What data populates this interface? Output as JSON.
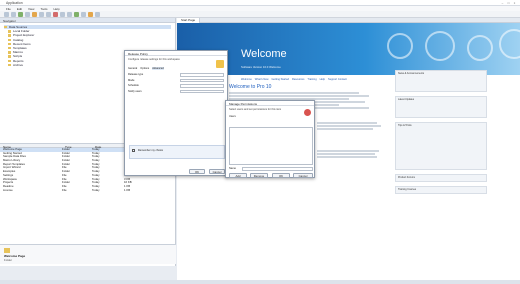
{
  "menu": [
    "File",
    "Edit",
    "View",
    "Tools",
    "Help"
  ],
  "left_pane": {
    "header": "Navigator",
    "tree": [
      "Data Sources",
      "Local Folder",
      "Project Explorer",
      "Catalog",
      "Recent Items",
      "Templates",
      "Macros",
      "Scripts",
      "Reports",
      "Archive"
    ],
    "columns": [
      "Name",
      "Type",
      "Date",
      "Size"
    ],
    "rows": [
      [
        "Welcome Page",
        "Folder",
        "Today",
        "4 KB"
      ],
      [
        "Getting Started",
        "Folder",
        "Today",
        "12 KB"
      ],
      [
        "Sample Data Files",
        "Folder",
        "Today",
        "8 KB"
      ],
      [
        "Macro Library",
        "Folder",
        "Today",
        "6 KB"
      ],
      [
        "Report Templates",
        "Folder",
        "Today",
        "10 KB"
      ],
      [
        "Import Wizard",
        "File",
        "Today",
        "2 KB"
      ],
      [
        "Examples",
        "Folder",
        "Today",
        "20 KB"
      ],
      [
        "Settings",
        "File",
        "Today",
        "1 KB"
      ],
      [
        "Workspace",
        "File",
        "Today",
        "3 KB"
      ],
      [
        "Projects",
        "Folder",
        "Today",
        "16 KB"
      ],
      [
        "Readme",
        "File",
        "Today",
        "1 KB"
      ],
      [
        "License",
        "File",
        "Today",
        "1 KB"
      ]
    ],
    "status_title": "Welcome Page",
    "status_line": "Folder"
  },
  "right_pane": {
    "tab": "Start Page",
    "banner_title": "Welcome",
    "banner_subtitle": "Software Version 10.0 Welcome",
    "nav_links": [
      "Welcome",
      "What's New",
      "Getting Started",
      "Resources",
      "Training",
      "Help",
      "Support Contact"
    ],
    "welcome_heading": "Welcome to Pro 10",
    "side_boxes": [
      "News & Announcements",
      "Latest Updates",
      "Tips & Tricks",
      "Product Forums",
      "Training Courses"
    ]
  },
  "dialog1": {
    "title": "Release Policy",
    "description": "Configure release settings for this workspace",
    "tabs": [
      "General",
      "Options",
      "Advanced"
    ],
    "labels": [
      "Release type",
      "Mode",
      "Schedule",
      "Notify users"
    ],
    "checkbox_label": "Remember my choice",
    "ok": "OK",
    "cancel": "Cancel"
  },
  "dialog2": {
    "title": "Manage Permissions",
    "description": "Select users and set permissions for this item",
    "list_label": "Users",
    "name_label": "Name",
    "buttons": [
      "Add",
      "Remove",
      "OK",
      "Cancel"
    ]
  }
}
